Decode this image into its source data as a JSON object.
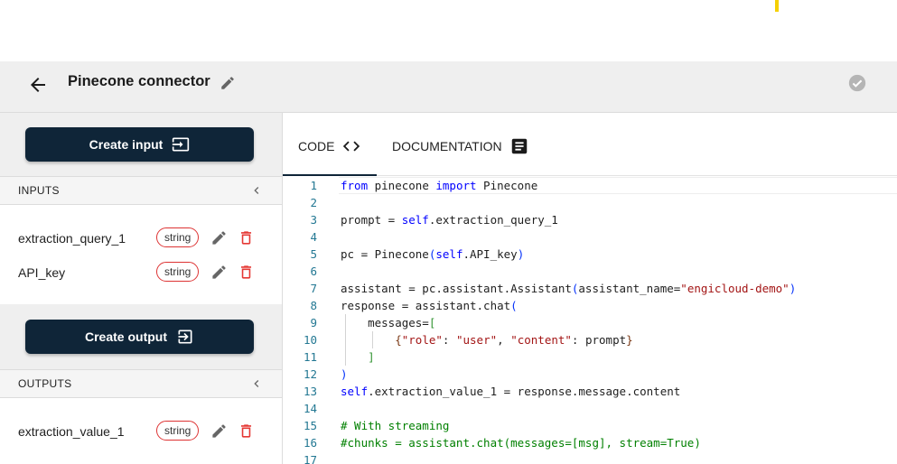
{
  "header": {
    "title": "Pinecone connector",
    "back_icon": "arrow-left-icon",
    "edit_icon": "pencil-icon",
    "status_icon": "check-circle-icon"
  },
  "sidebar": {
    "create_input_label": "Create input",
    "create_output_label": "Create output",
    "inputs_heading": "INPUTS",
    "outputs_heading": "OUTPUTS",
    "inputs": [
      {
        "name": "extraction_query_1",
        "type": "string"
      },
      {
        "name": "API_key",
        "type": "string"
      }
    ],
    "outputs": [
      {
        "name": "extraction_value_1",
        "type": "string"
      }
    ]
  },
  "tabs": {
    "code_label": "CODE",
    "docs_label": "DOCUMENTATION",
    "active": "CODE"
  },
  "editor": {
    "line_numbers": [
      "1",
      "2",
      "3",
      "4",
      "5",
      "6",
      "7",
      "8",
      "9",
      "10",
      "11",
      "12",
      "13",
      "14",
      "15",
      "16",
      "17"
    ],
    "lines": [
      "from pinecone import Pinecone",
      "",
      "prompt = self.extraction_query_1",
      "",
      "pc = Pinecone(self.API_key)",
      "",
      "assistant = pc.assistant.Assistant(assistant_name=\"engicloud-demo\")",
      "response = assistant.chat(",
      "    messages=[",
      "        {\"role\": \"user\", \"content\": prompt}",
      "    ]",
      ")",
      "self.extraction_value_1 = response.message.content",
      "",
      "# With streaming",
      "#chunks = assistant.chat(messages=[msg], stream=True)",
      ""
    ]
  },
  "colors": {
    "primary_dark": "#0f2538",
    "badge_border": "#dd3333",
    "delete_icon": "#e53935",
    "accent_marker": "#f5d000"
  }
}
